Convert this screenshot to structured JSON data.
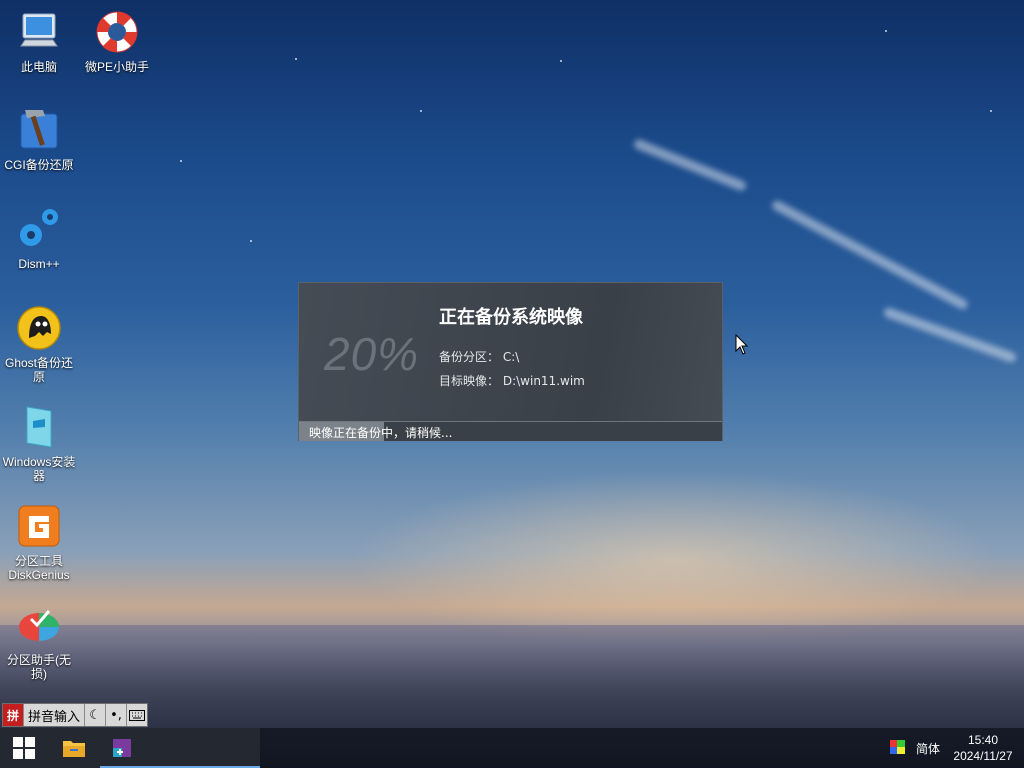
{
  "desktop_icons": [
    {
      "label": "此电脑",
      "icon": "computer-icon"
    },
    {
      "label": "微PE小助手",
      "icon": "lifebuoy-icon"
    },
    {
      "label": "CGI备份还原",
      "icon": "hammer-icon"
    },
    {
      "label": "Dism++",
      "icon": "gears-icon"
    },
    {
      "label": "Ghost备份还原",
      "icon": "ghost-icon"
    },
    {
      "label": "Windows安装器",
      "icon": "windows-installer-icon"
    },
    {
      "label": "分区工具DiskGenius",
      "icon": "diskgenius-icon"
    },
    {
      "label": "分区助手(无损)",
      "icon": "partition-assistant-icon"
    }
  ],
  "backup_dialog": {
    "percent_text": "20%",
    "title": "正在备份系统映像",
    "source_label": "备份分区：",
    "source_value": "C:\\",
    "target_label": "目标映像：",
    "target_value": "D:\\win11.wim",
    "status_text": "映像正在备份中，请稍候...",
    "progress": 0.2
  },
  "ime_bar": {
    "logo": "拼",
    "name": "拼音输入",
    "buttons": [
      "moon-icon",
      "punctuation-icon",
      "keyboard-icon"
    ]
  },
  "taskbar": {
    "pinned": [
      "windows-start-icon",
      "file-explorer-icon",
      "app-window-icon"
    ],
    "language": "简体",
    "time": "15:40",
    "date": "2024/11/27"
  },
  "colors": {
    "accent": "#6aa8e8",
    "ime_red": "#c41e1e"
  }
}
